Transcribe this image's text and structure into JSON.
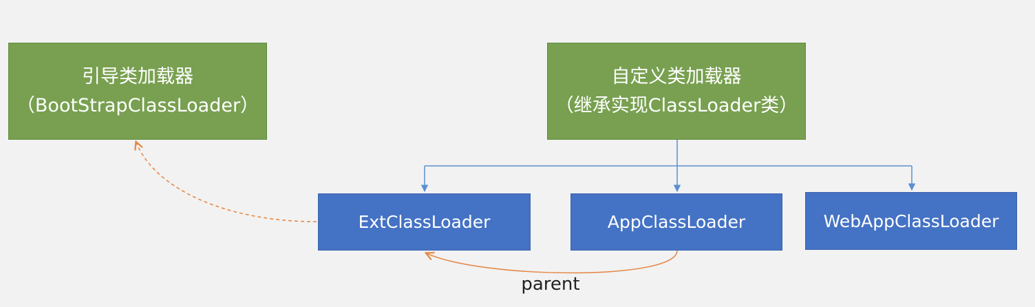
{
  "boxes": {
    "bootstrap": {
      "line1": "引导类加载器",
      "line2": "（BootStrapClassLoader）"
    },
    "custom": {
      "line1": "自定义类加载器",
      "line2": "（继承实现ClassLoader类）"
    },
    "ext": {
      "label": "ExtClassLoader"
    },
    "app": {
      "label": "AppClassLoader"
    },
    "webapp": {
      "label": "WebAppClassLoader"
    }
  },
  "edges": {
    "parent_label": "parent"
  },
  "colors": {
    "green_box": "#78a050",
    "blue_box": "#4472c4",
    "tree_line": "#5b8fd0",
    "parent_arrow": "#e58a4a",
    "background": "#f2f2f2"
  }
}
